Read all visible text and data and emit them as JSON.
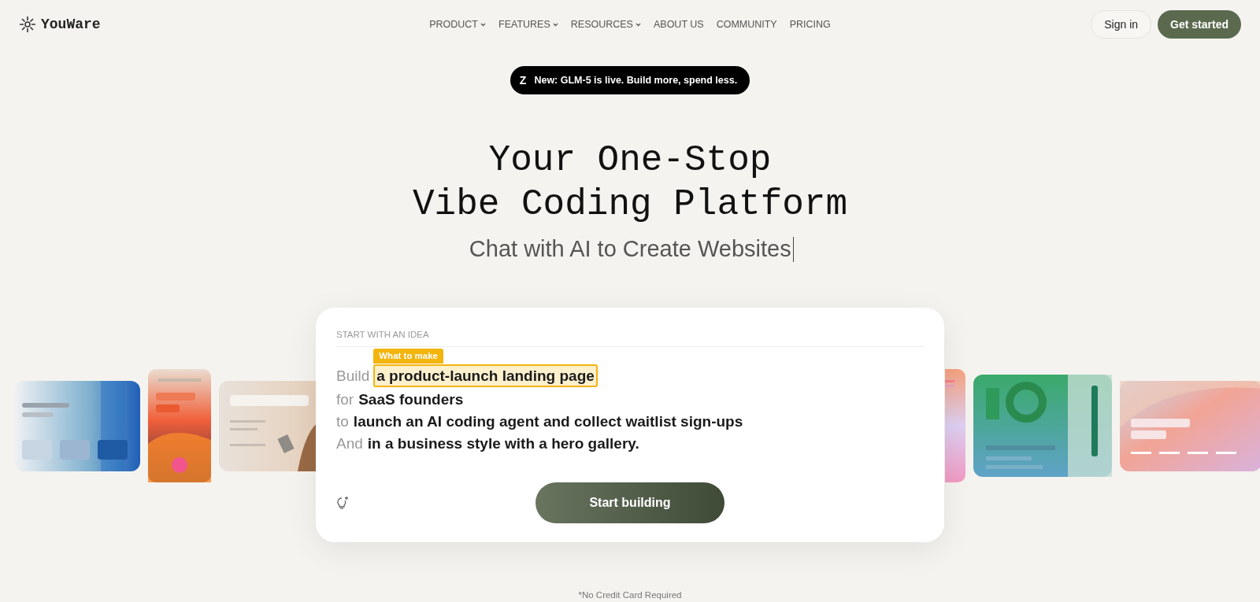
{
  "header": {
    "logo": "YouWare",
    "nav": [
      {
        "label": "PRODUCT",
        "dropdown": true
      },
      {
        "label": "FEATURES",
        "dropdown": true
      },
      {
        "label": "RESOURCES",
        "dropdown": true
      },
      {
        "label": "ABOUT US",
        "dropdown": false
      },
      {
        "label": "COMMUNITY",
        "dropdown": false
      },
      {
        "label": "PRICING",
        "dropdown": false
      }
    ],
    "sign_in": "Sign in",
    "get_started": "Get started"
  },
  "announcement": {
    "icon": "Z",
    "text": "New: GLM-5 is live. Build more, spend less."
  },
  "hero": {
    "title_lines": [
      "Your One-Stop",
      "Vibe Coding Platform"
    ],
    "subtitle": "Chat with AI to Create Websites"
  },
  "prompt": {
    "heading": "START WITH AN IDEA",
    "lines": [
      {
        "prefix": "Build",
        "value": "a product-launch landing page",
        "focused": true,
        "tag": "What to make"
      },
      {
        "prefix": "for",
        "value": "SaaS founders",
        "focused": false
      },
      {
        "prefix": "to",
        "value": "launch an AI coding agent and collect waitlist sign-ups",
        "focused": false
      },
      {
        "prefix": "And",
        "value": "in a business style with a hero gallery.",
        "focused": false
      }
    ],
    "button": "Start building"
  },
  "footnote": "*No Credit Card Required"
}
